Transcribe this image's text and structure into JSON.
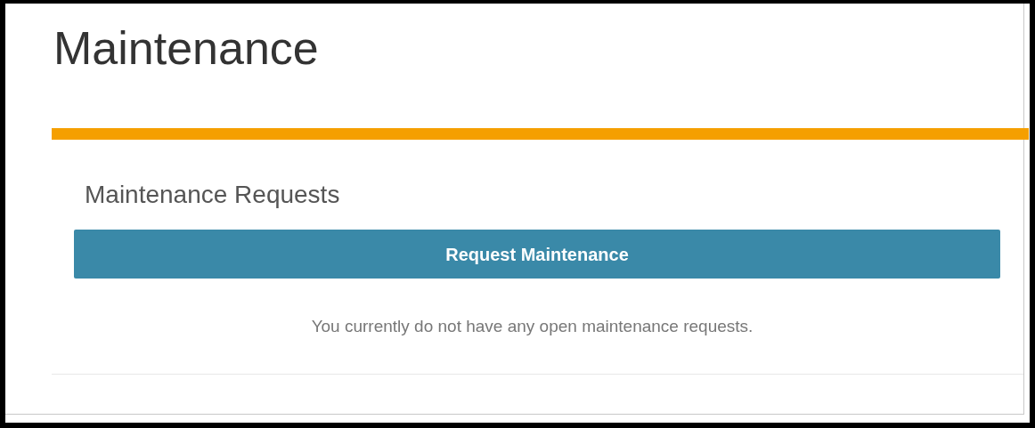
{
  "page": {
    "title": "Maintenance"
  },
  "section": {
    "title": "Maintenance Requests",
    "button": "Request Maintenance",
    "message": "You currently do not have any open maintenance requests."
  }
}
